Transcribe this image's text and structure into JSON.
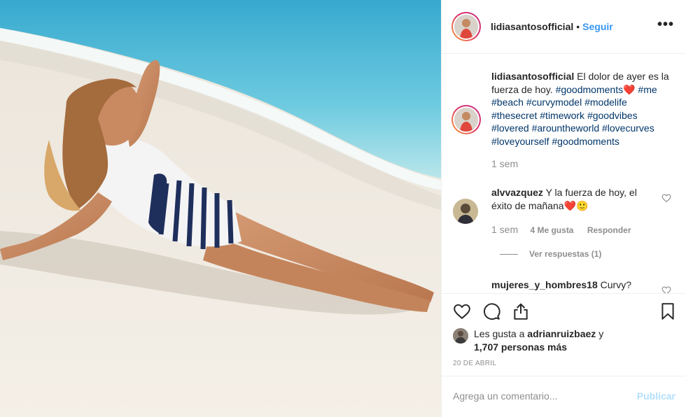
{
  "post": {
    "username": "lidiasantosofficial",
    "dot": "•",
    "follow_label": "Seguir",
    "more": "•••"
  },
  "caption": {
    "username": "lidiasantosofficial",
    "text_start": "El dolor de ayer es la fuerza de hoy.",
    "tags": [
      "#goodmoments",
      "#me",
      "#beach",
      "#curvymodel",
      "#modelife",
      "#thesecret",
      "#timework",
      "#goodvibes",
      "#lovered",
      "#arountheworld",
      "#lovecurves",
      "#loveyourself",
      "#goodmoments"
    ],
    "heart": "❤️",
    "time": "1 sem"
  },
  "comments": [
    {
      "username": "alvvazquez",
      "text": "Y la fuerza de hoy, el éxito de mañana",
      "emoji": "❤️🙂",
      "time": "1 sem",
      "likes": "4 Me gusta",
      "reply_label": "Responder",
      "view_replies": "Ver respuestas (1)"
    },
    {
      "username": "mujeres_y_hombres18",
      "text": "Curvy?"
    }
  ],
  "liked_by": {
    "prefix": "Les gusta a",
    "user": "adrianruizbaez",
    "mid": "y",
    "others": "1,707 personas más"
  },
  "date": "20 DE ABRIL",
  "add_comment": {
    "placeholder": "Agrega un comentario...",
    "publish": "Publicar"
  },
  "colors": {
    "link_blue": "#3897f0",
    "hashtag": "#003569",
    "muted": "#8e8e8e",
    "publish_disabled": "#b2dffc",
    "heart_red": "#e8322b"
  },
  "icons": [
    "more-icon",
    "heart-icon",
    "comment-icon",
    "share-icon",
    "bookmark-icon",
    "small-heart-icon"
  ]
}
